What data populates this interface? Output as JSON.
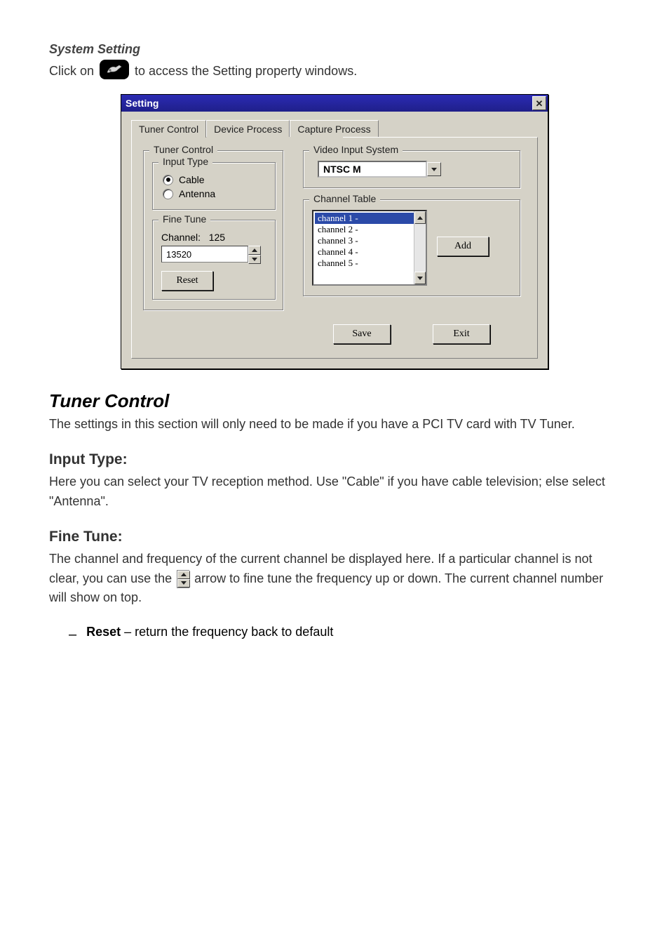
{
  "page": {
    "intro_line": "System Setting",
    "icon_line1": "Click on ",
    "icon_line2": " to access the Setting property windows."
  },
  "window": {
    "title": "Setting",
    "close_glyph": "✕",
    "tabs": [
      {
        "label": "Tuner Control"
      },
      {
        "label": "Device Process"
      },
      {
        "label": "Capture Process"
      }
    ],
    "tuner_group_label": "Tuner Control",
    "input_type_label": "Input Type",
    "radio_cable": "Cable",
    "radio_antenna": "Antenna",
    "fine_tune_label": "Fine Tune",
    "channel_prefix": "Channel:",
    "channel_num": "125",
    "fine_value": "13520",
    "reset_btn": "Reset",
    "vis_label": "Video Input System",
    "vis_value": "NTSC M",
    "channel_table_label": "Channel Table",
    "channels": [
      {
        "label": "channel 1 -"
      },
      {
        "label": "channel 2 -"
      },
      {
        "label": "channel 3 -"
      },
      {
        "label": "channel 4 -"
      },
      {
        "label": "channel 5 -"
      }
    ],
    "add_btn": "Add",
    "save_btn": "Save",
    "exit_btn": "Exit"
  },
  "desc": {
    "tuner_control_title": "Tuner Control",
    "tuner_control_body": "The settings in this section will only need to be made if you have a PCI TV card with TV Tuner.",
    "input_type_title": "Input Type:",
    "input_type_body": "Here you can select your TV reception method. Use \"Cable\" if you have cable television; else select \"Antenna\".",
    "fine_tune_title": "Fine Tune:",
    "fine_tune_body1": "The channel and frequency of the current channel be displayed here. If a particular channel is not clear, you can use the",
    "fine_tune_body2": " arrow to fine tune the frequency up or down. The current channel number will show on top.",
    "bullet_reset_label": "Reset",
    "bullet_reset_body": " – return the frequency back to default"
  }
}
